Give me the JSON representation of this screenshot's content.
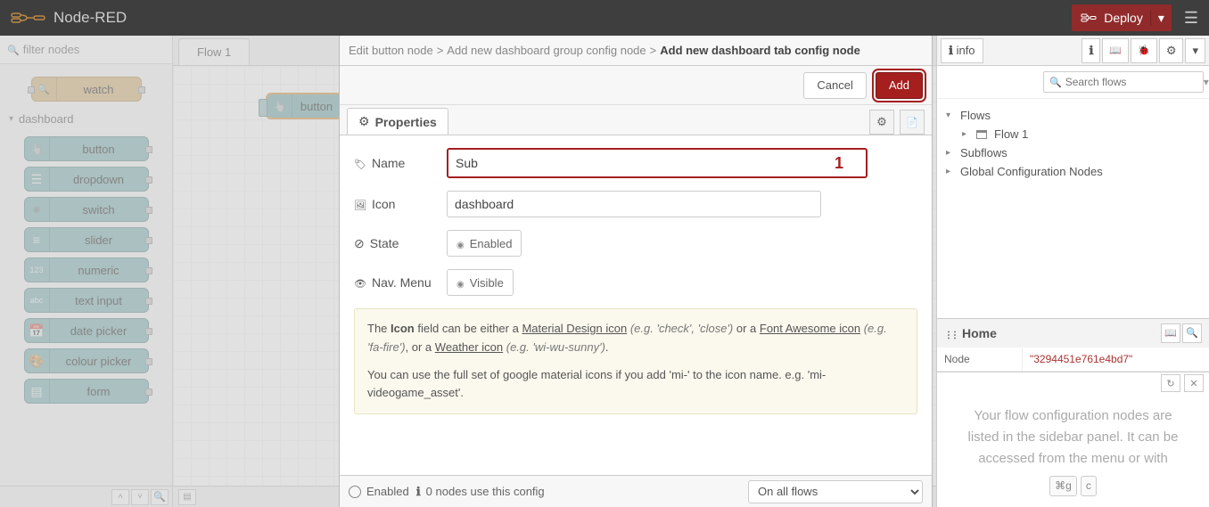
{
  "header": {
    "title": "Node-RED",
    "deploy_label": "Deploy"
  },
  "palette": {
    "filter_placeholder": "filter nodes",
    "watch_label": "watch",
    "category": "dashboard",
    "nodes": [
      "button",
      "dropdown",
      "switch",
      "slider",
      "numeric",
      "text input",
      "date picker",
      "colour picker",
      "form"
    ]
  },
  "tabs": {
    "flow1": "Flow 1"
  },
  "canvas_node": {
    "label": "button"
  },
  "editor": {
    "breadcrumb": [
      "Edit button node",
      "Add new dashboard group config node",
      "Add new dashboard tab config node"
    ],
    "cancel": "Cancel",
    "add": "Add",
    "tab_properties": "Properties",
    "form": {
      "name_label": "Name",
      "name_value": "Sub",
      "callout_num": "1",
      "icon_label": "Icon",
      "icon_value": "dashboard",
      "state_label": "State",
      "state_toggle": "Enabled",
      "nav_label": "Nav. Menu",
      "nav_toggle": "Visible"
    },
    "info": {
      "t1": "The ",
      "t2": "Icon",
      "t3": " field can be either a ",
      "l1": "Material Design icon",
      "e1": " (e.g. 'check', 'close')",
      "t4": " or a ",
      "l2": "Font Awesome icon",
      "e2": " (e.g. 'fa-fire')",
      "t5": ", or a ",
      "l3": "Weather icon",
      "e3": " (e.g. 'wi-wu-sunny')",
      "t6": ".",
      "p2": "You can use the full set of google material icons if you add 'mi-' to the icon name. e.g. 'mi-videogame_asset'."
    },
    "footer": {
      "enabled": "Enabled",
      "usage": "0 nodes use this config",
      "scope": "On all flows"
    }
  },
  "sidebar": {
    "info_tab": "info",
    "search_placeholder": "Search flows",
    "tree": {
      "flows": "Flows",
      "flow1": "Flow 1",
      "subflows": "Subflows",
      "gcn": "Global Configuration Nodes"
    },
    "home": "Home",
    "node_k": "Node",
    "node_v": "\"3294451e761e4bd7\"",
    "tip_line1": "Your flow configuration nodes are",
    "tip_line2": "listed in the sidebar panel. It can be",
    "tip_line3": "accessed from the menu or with",
    "key1": "⌘g",
    "key2": "c"
  }
}
